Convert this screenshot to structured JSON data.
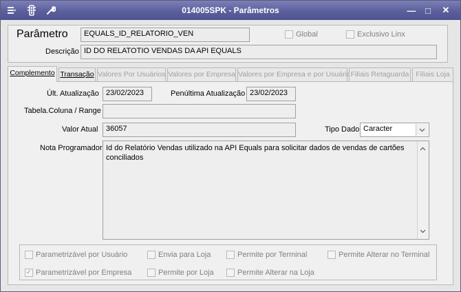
{
  "window": {
    "title": "014005SPK - Parâmetros",
    "icons": [
      "menu-icon",
      "traffic-light-icon",
      "wrench-icon"
    ],
    "controls": {
      "minimize": "—",
      "maximize": "□",
      "close": "✕"
    }
  },
  "header": {
    "param_label": "Parâmetro",
    "param_value": "EQUALS_ID_RELATORIO_VEN",
    "global_label": "Global",
    "exclusive_label": "Exclusivo Linx",
    "description_label": "Descrição",
    "description_value": "ID DO RELATOTIO VENDAS DA API EQUALS"
  },
  "tabs": [
    {
      "label": "Complemento",
      "state": "active"
    },
    {
      "label": "Transação",
      "state": "enabled"
    },
    {
      "label": "Valores Por Usuários",
      "state": "disabled"
    },
    {
      "label": "Valores por Empresa",
      "state": "disabled"
    },
    {
      "label": "Valores por Empresa e por Usuário",
      "state": "disabled"
    },
    {
      "label": "Filiais Retaguarda",
      "state": "disabled"
    },
    {
      "label": "Filiais Loja",
      "state": "disabled"
    }
  ],
  "complemento": {
    "last_update_label": "Últ. Atualização",
    "last_update_value": "23/02/2023",
    "penultimate_label": "Penúltima Atualização",
    "penultimate_value": "23/02/2023",
    "table_column_label": "Tabela.Coluna / Range",
    "table_column_value": "",
    "current_value_label": "Valor Atual",
    "current_value": "36057",
    "data_type_label": "Tipo Dado",
    "data_type_value": "Caracter",
    "note_label": "Nota Programador",
    "note_value": "Id do Relatório Vendas utilizado na API Equals para solicitar dados de vendas de cartões conciliados"
  },
  "checkboxes": [
    {
      "label": "Parametrizável por Usuário",
      "checked": false
    },
    {
      "label": "Envia para Loja",
      "checked": false
    },
    {
      "label": "Permite por Terminal",
      "checked": false
    },
    {
      "label": "Permite Alterar no Terminal",
      "checked": false
    },
    {
      "label": "Parametrizável por Empresa",
      "checked": true
    },
    {
      "label": "Permite por Loja",
      "checked": false
    },
    {
      "label": "Permite Alterar na Loja",
      "checked": false
    }
  ]
}
